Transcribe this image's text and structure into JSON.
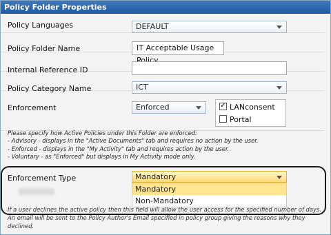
{
  "window": {
    "title": "Policy Folder Properties"
  },
  "form": {
    "policy_languages": {
      "label": "Policy Languages",
      "value": "DEFAULT"
    },
    "policy_folder_name": {
      "label": "Policy Folder Name",
      "value": "IT Acceptable Usage Policy"
    },
    "internal_reference_id": {
      "label": "Internal Reference ID",
      "value": ""
    },
    "policy_category_name": {
      "label": "Policy Category Name",
      "value": "ICT"
    },
    "enforcement": {
      "label": "Enforcement",
      "value": "Enforced",
      "checkboxes": [
        {
          "label": "LANconsent",
          "checked": true
        },
        {
          "label": "Portal",
          "checked": false
        }
      ]
    },
    "help_lines": [
      "Please specify how Active Policies under this Folder are enforced:",
      "- Advisory - displays in the \"Active Documents\" tab and requires no action by the user.",
      "- Enforced - displays in the \"My Activity\" tab and requires action by the user.",
      "- Voluntary - as \"Enforced\" but displays in My Activity mode only."
    ],
    "enforcement_type": {
      "label": "Enforcement Type",
      "value": "Mandatory",
      "options": [
        "Mandatory",
        "Non-Mandatory"
      ]
    },
    "note_lines": [
      "If a user declines the active policy then this field will allow the user access for the specified number of days.",
      "An email will be sent to the Policy Author's Email specified in policy group giving the reasons why they",
      "declined."
    ]
  }
}
